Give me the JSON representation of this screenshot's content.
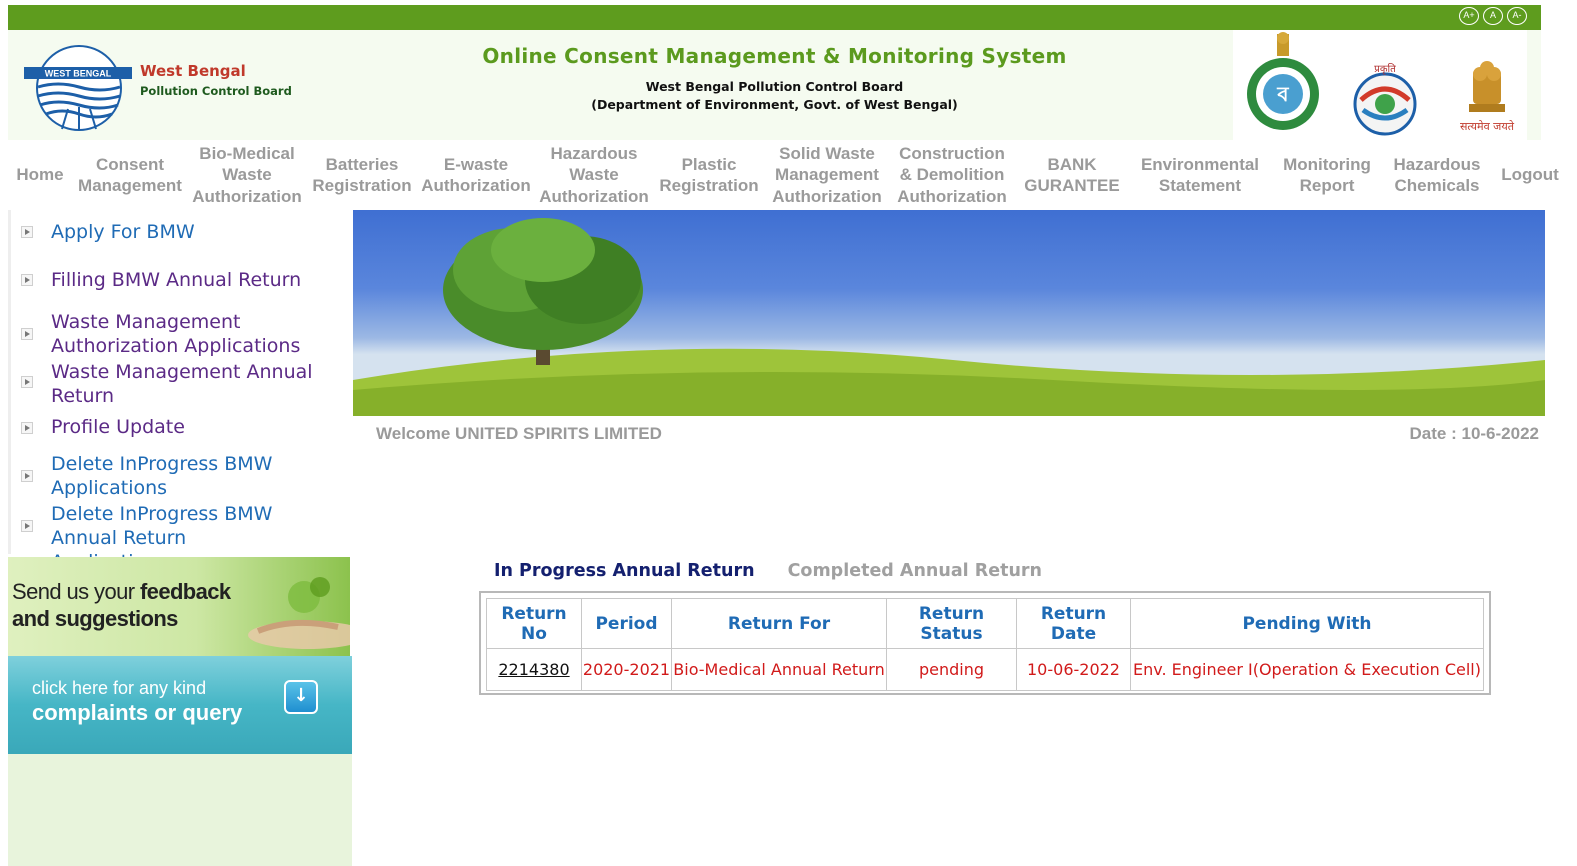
{
  "font_controls": [
    "A+",
    "A",
    "A-"
  ],
  "header": {
    "logo_badge": "WEST BENGAL",
    "logo_line1": "West Bengal",
    "logo_line2": "Pollution Control Board",
    "title": "Online Consent Management & Monitoring System",
    "subtitle1": "West Bengal Pollution Control Board",
    "subtitle2": "(Department of Environment, Govt. of West Bengal)",
    "emblem_motto": "सत्यमेव जयते"
  },
  "nav": [
    "Home",
    "Consent\nManagement",
    "Bio-Medical\nWaste\nAuthorization",
    "Batteries\nRegistration",
    "E-waste\nAuthorization",
    "Hazardous\nWaste\nAuthorization",
    "Plastic\nRegistration",
    "Solid Waste\nManagement\nAuthorization",
    "Construction\n& Demolition\nAuthorization",
    "BANK\nGURANTEE",
    "Environmental\nStatement",
    "Monitoring\nReport",
    "Hazardous\nChemicals",
    "Logout"
  ],
  "sidebar": {
    "items": [
      {
        "label": "Apply For BMW"
      },
      {
        "label": "Filling BMW Annual Return"
      },
      {
        "label": "Waste Management Authorization Applications"
      },
      {
        "label": "Waste Management Annual Return"
      },
      {
        "label": "Profile Update"
      },
      {
        "label": "Delete InProgress BMW Applications"
      },
      {
        "label": "Delete InProgress BMW Annual Return Applications"
      }
    ],
    "feedback_line1_normal": "Send us your",
    "feedback_line1_bold": "feedback",
    "feedback_line2": "and suggestions",
    "complaint_line1": "click here for any kind",
    "complaint_line2": "complaints or query",
    "complaint_icon": "down-arrow-icon"
  },
  "welcome": "Welcome UNITED SPIRITS LIMITED",
  "date": "Date : 10-6-2022",
  "tabs": {
    "active": "In Progress Annual Return",
    "inactive": "Completed Annual Return"
  },
  "table": {
    "headers": [
      "Return No",
      "Period",
      "Return For",
      "Return Status",
      "Return Date",
      "Pending With"
    ],
    "rows": [
      {
        "return_no": "2214380",
        "period": "2020-2021",
        "return_for": "Bio-Medical Annual Return",
        "status": "pending",
        "date": "10-06-2022",
        "pending_with": "Env. Engineer I(Operation & Execution Cell)"
      }
    ]
  },
  "colors": {
    "brand_green": "#5e9c1e",
    "link_blue": "#1f6bb5",
    "visited_purple": "#5b2a86",
    "tab_navy": "#14206f",
    "value_red": "#d11a1a"
  }
}
